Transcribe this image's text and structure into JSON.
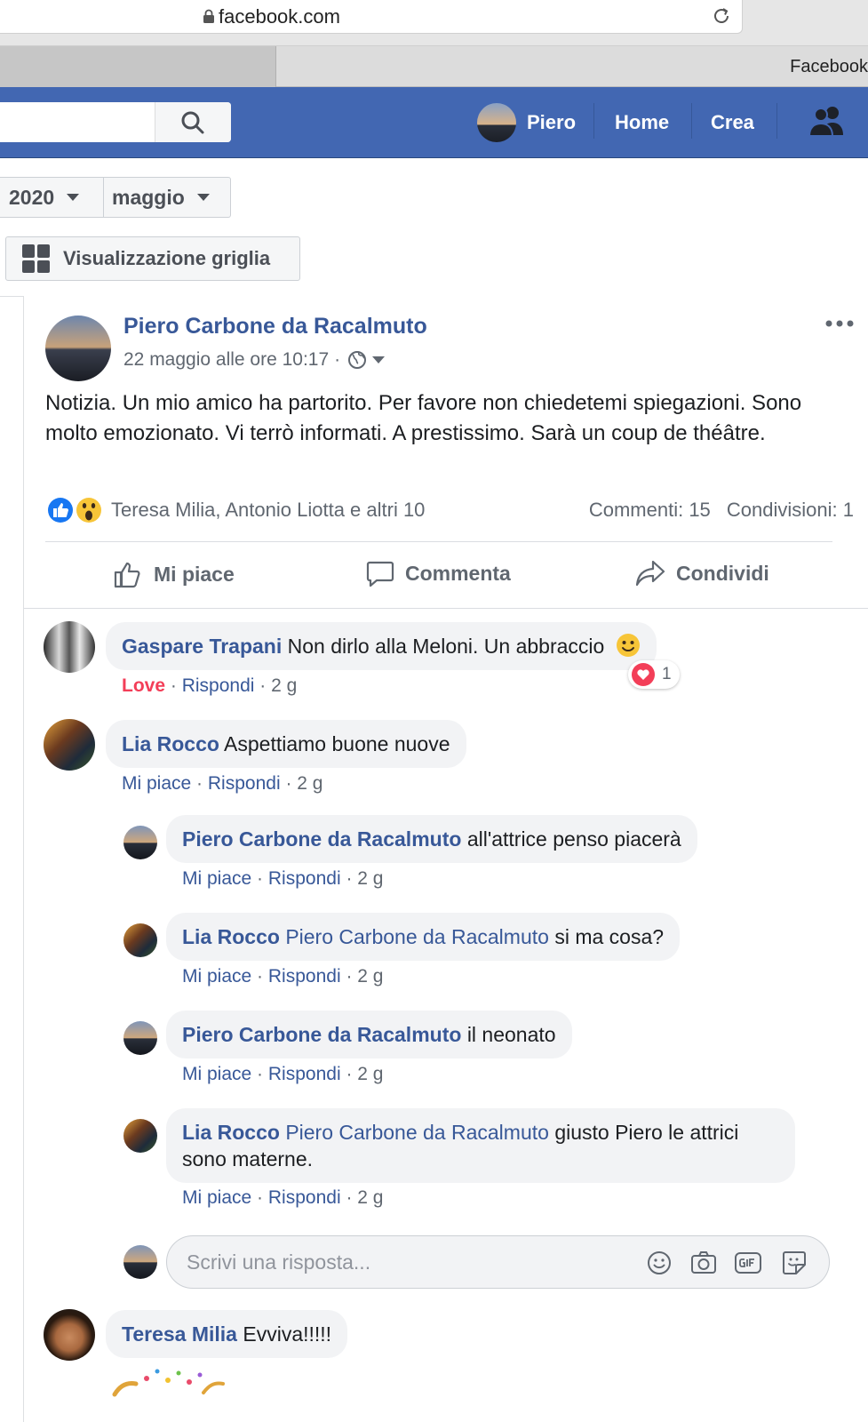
{
  "browser": {
    "url": "facebook.com",
    "tab_title": "Facebook"
  },
  "navbar": {
    "profile_name": "Piero",
    "home": "Home",
    "create": "Crea"
  },
  "filters": {
    "year": "2020",
    "month": "maggio",
    "grid_view": "Visualizzazione griglia"
  },
  "post": {
    "author": "Piero Carbone da Racalmuto",
    "timestamp": "22 maggio alle ore 10:17",
    "separator": "·",
    "text": "Notizia. Un mio amico ha partorito. Per favore non chiedetemi spiegazioni. Sono molto emozionato. Vi terrò informati. A prestissimo. Sarà un coup de théâtre.",
    "reactions_text": "Teresa Milia, Antonio Liotta e altri 10",
    "comments_count": "Commenti: 15",
    "shares_count": "Condivisioni: 1",
    "actions": {
      "like": "Mi piace",
      "comment": "Commenta",
      "share": "Condividi"
    }
  },
  "comments": [
    {
      "author": "Gaspare Trapani",
      "text": "Non dirlo alla Meloni. Un abbraccio",
      "reaction": "Love",
      "reply": "Rispondi",
      "age": "2 g",
      "heart_count": "1"
    },
    {
      "author": "Lia Rocco",
      "text": "Aspettiamo buone nuove",
      "like": "Mi piace",
      "reply": "Rispondi",
      "age": "2 g"
    },
    {
      "author": "Piero Carbone da Racalmuto",
      "text": "all'attrice penso piacerà",
      "like": "Mi piace",
      "reply": "Rispondi",
      "age": "2 g"
    },
    {
      "author": "Lia Rocco",
      "mention": "Piero Carbone da Racalmuto",
      "text": "si ma cosa?",
      "like": "Mi piace",
      "reply": "Rispondi",
      "age": "2 g"
    },
    {
      "author": "Piero Carbone da Racalmuto",
      "text": "il neonato",
      "like": "Mi piace",
      "reply": "Rispondi",
      "age": "2 g"
    },
    {
      "author": "Lia Rocco",
      "mention": "Piero Carbone da Racalmuto",
      "text": "giusto Piero le attrici sono materne.",
      "like": "Mi piace",
      "reply": "Rispondi",
      "age": "2 g"
    },
    {
      "author": "Teresa Milia",
      "text": "Evviva!!!!!"
    }
  ],
  "reply_box": {
    "placeholder": "Scrivi una risposta..."
  },
  "dot": "·",
  "icons": [
    "lock-icon",
    "reload-icon",
    "search-icon",
    "friends-icon",
    "grid-icon",
    "globe-icon",
    "more-icon",
    "like-react-icon",
    "wow-react-icon",
    "thumbs-up-icon",
    "comment-icon",
    "share-icon",
    "smiley-icon",
    "heart-icon",
    "emoji-icon",
    "camera-icon",
    "gif-icon",
    "sticker-icon"
  ],
  "colors": {
    "fb_blue": "#4267b2",
    "link": "#385898",
    "love": "#f33e58",
    "bubble": "#f2f3f5"
  }
}
